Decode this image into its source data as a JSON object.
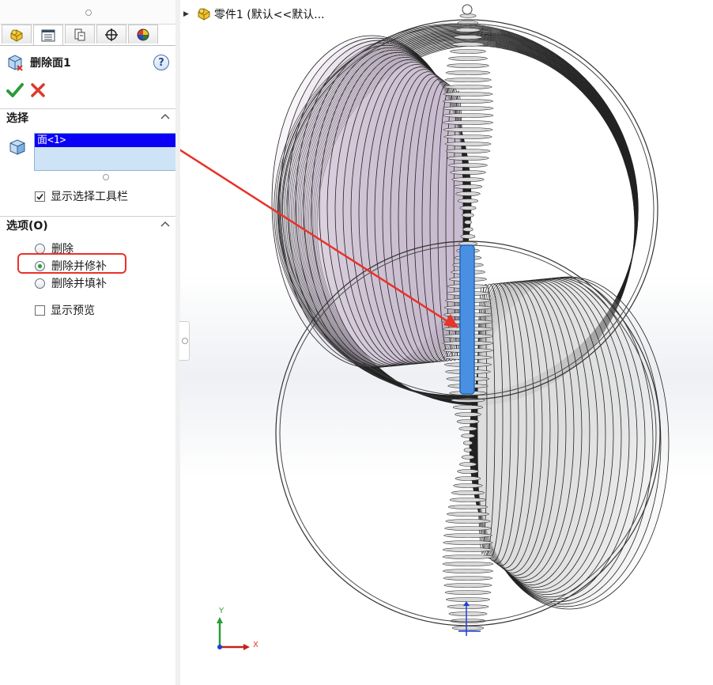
{
  "feature": {
    "title": "删除面1",
    "help_glyph": "?"
  },
  "tabs": [
    {
      "name": "featuremanager-tab",
      "icon": "part-icon"
    },
    {
      "name": "propertymanager-tab",
      "icon": "propertymanager-icon",
      "active": true
    },
    {
      "name": "configurationmanager-tab",
      "icon": "configuration-icon"
    },
    {
      "name": "dimxpert-tab",
      "icon": "crosshair-icon"
    },
    {
      "name": "display-manager-tab",
      "icon": "appearance-icon"
    }
  ],
  "selection": {
    "header": "选择",
    "items": [
      "面<1>"
    ],
    "show_toolbar_label": "显示选择工具栏",
    "show_toolbar_checked": true
  },
  "options": {
    "header": "选项(O)",
    "radios": [
      {
        "label": "删除",
        "selected": false
      },
      {
        "label": "删除并修补",
        "selected": true
      },
      {
        "label": "删除并填补",
        "selected": false
      }
    ],
    "show_preview_label": "显示预览",
    "show_preview_checked": false
  },
  "tree": {
    "label": "零件1 (默认<<默认..."
  },
  "triad": {
    "x": "X",
    "y": "Y"
  },
  "colors": {
    "accent_blue": "#0a00f5",
    "selected_face": "#4a90e2",
    "annotation_red": "#e8322a",
    "ok_green": "#2b9b3a"
  }
}
